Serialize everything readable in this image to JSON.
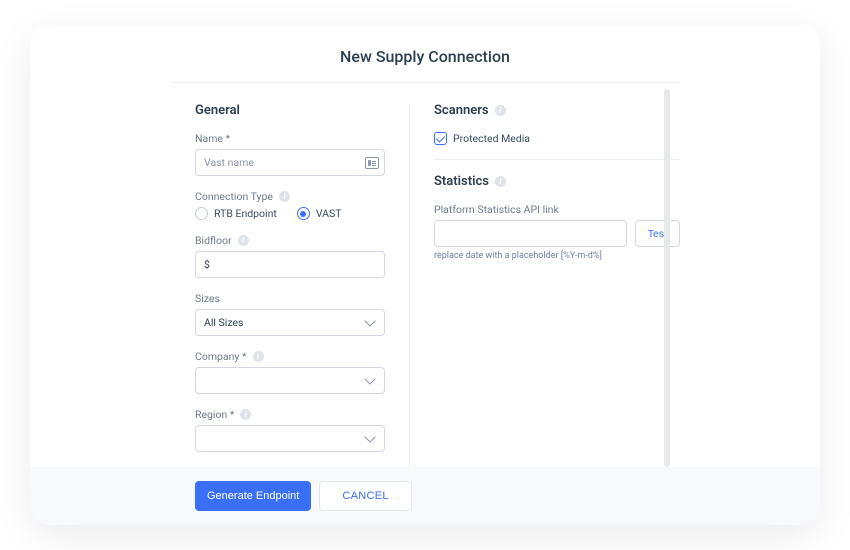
{
  "title": "New Supply Connection",
  "general": {
    "heading": "General",
    "name_label": "Name *",
    "name_placeholder": "Vast name",
    "name_value": "",
    "connection_type_label": "Connection Type",
    "connection_options": [
      {
        "label": "RTB Endpoint",
        "checked": false
      },
      {
        "label": "VAST",
        "checked": true
      }
    ],
    "bidfloor_label": "Bidfloor",
    "bidfloor_value": "$",
    "sizes_label": "Sizes",
    "sizes_value": "All Sizes",
    "company_label": "Company *",
    "company_value": "",
    "region_label": "Region *",
    "region_value": ""
  },
  "scanners": {
    "heading": "Scanners",
    "items": [
      {
        "label": "Protected Media",
        "checked": true
      }
    ]
  },
  "statistics": {
    "heading": "Statistics",
    "api_label": "Platform Statistics API link",
    "api_value": "",
    "test_label": "Test",
    "hint": "replace date with a placeholder [%Y-m-d%]"
  },
  "footer": {
    "generate_label": "Generate Endpoint",
    "cancel_label": "CANCEL"
  }
}
